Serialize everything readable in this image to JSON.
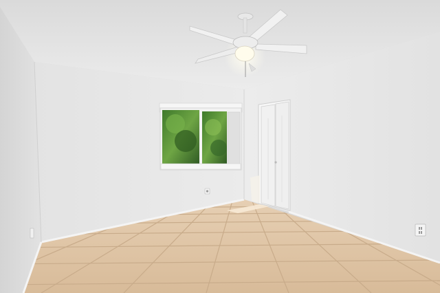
{
  "scene": {
    "palette": {
      "ceiling": "#e3e3e3",
      "ceiling_shadow": "#d2d2d2",
      "left_wall": "#dcdcdc",
      "back_wall": "#e6e6e6",
      "right_wall": "#e9e9e9",
      "floor": "#dcc0a0",
      "grout": "#c4a98a",
      "baseboard": "#f2f2f2",
      "window_frame": "#f4f4f4",
      "foliage_dark": "#2e5a22",
      "foliage_light": "#5f9a3a",
      "closet_door": "#f3f3f3",
      "fan_body": "#efefef",
      "fan_shadow": "#bdbdbd",
      "light_glow": "#fffbe8",
      "sunlight": "#f5e6d0"
    },
    "fixtures": [
      {
        "name": "ceiling-fan",
        "blades": 4,
        "has_light": true
      },
      {
        "name": "window",
        "panes": 2,
        "has_blind": true
      },
      {
        "name": "closet",
        "doors": 2,
        "style": "bi-fold"
      },
      {
        "name": "wall-outlet-left"
      },
      {
        "name": "wall-outlet-back"
      },
      {
        "name": "wall-outlet-right"
      }
    ],
    "floor": {
      "material": "ceramic-tile"
    }
  }
}
